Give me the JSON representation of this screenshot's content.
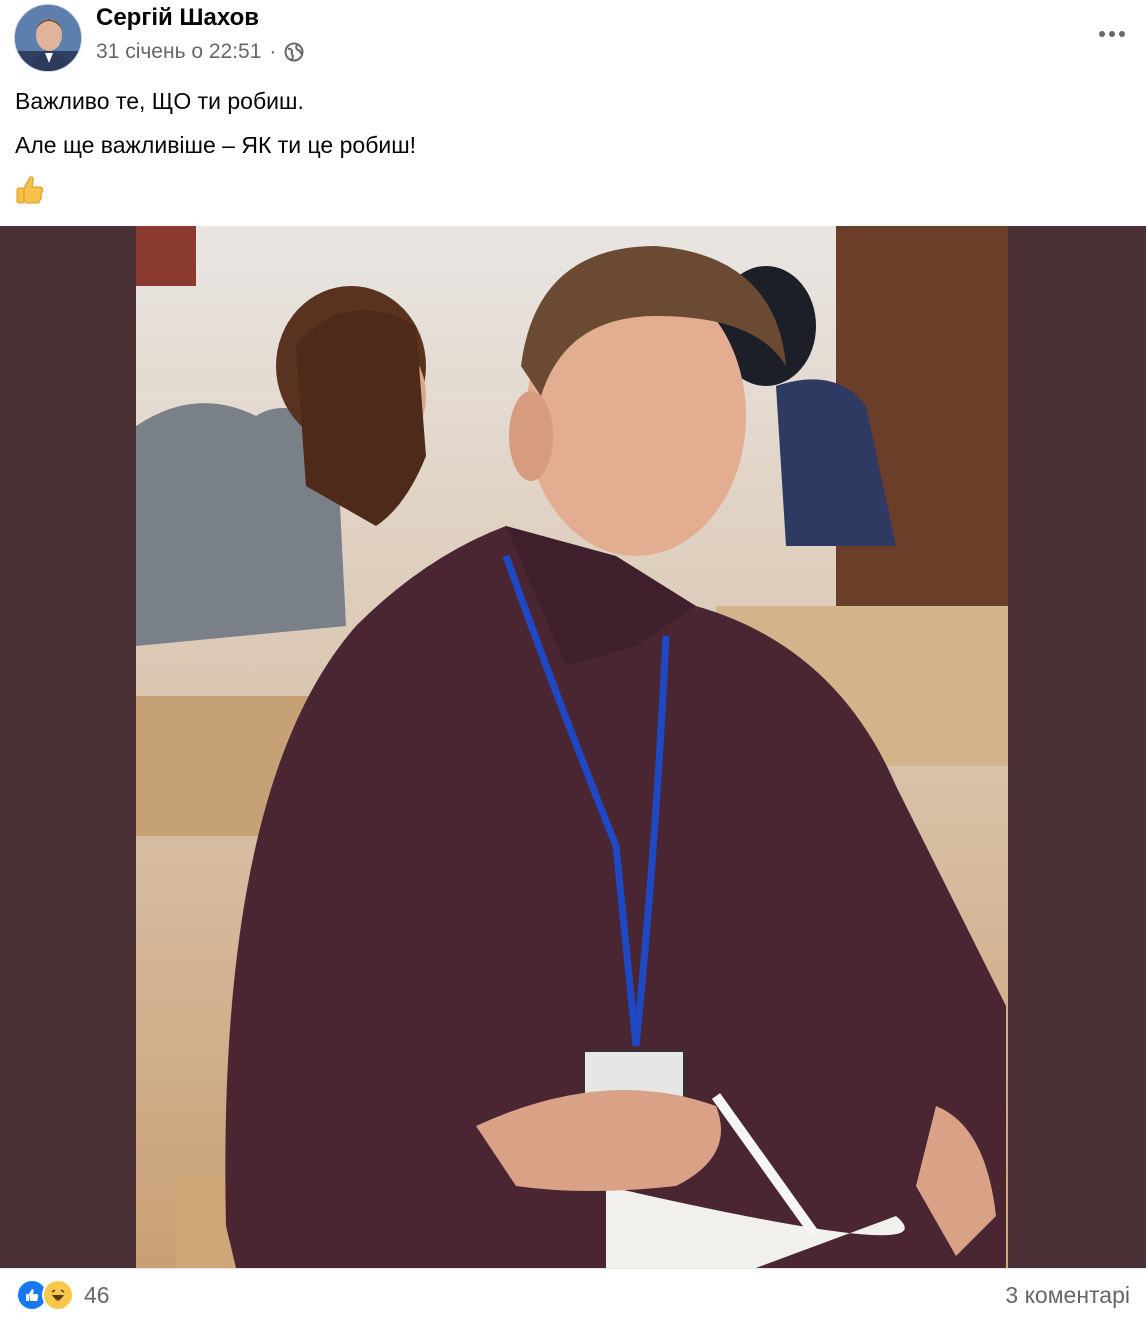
{
  "post": {
    "author": "Сергій Шахов",
    "timestamp": "31 січень о 22:51",
    "separator": "·",
    "audience_icon": "globe-icon",
    "menu_icon": "more-options-icon",
    "text_line_1": "Важливо те, ЩО ти робиш.",
    "text_line_2": "Але ще важливіше – ЯК ти це робиш!",
    "emoji": "thumbs-up-emoji",
    "photo_icon": "photo-image"
  },
  "footer": {
    "reactions": [
      "like-reaction-icon",
      "haha-reaction-icon"
    ],
    "reaction_count": "46",
    "comments_label": "3 коментарі"
  },
  "colors": {
    "photo_background": "#4b3035",
    "like_blue": "#1877f2",
    "haha_yellow": "#f7c84b",
    "secondary_text": "#65676b"
  }
}
